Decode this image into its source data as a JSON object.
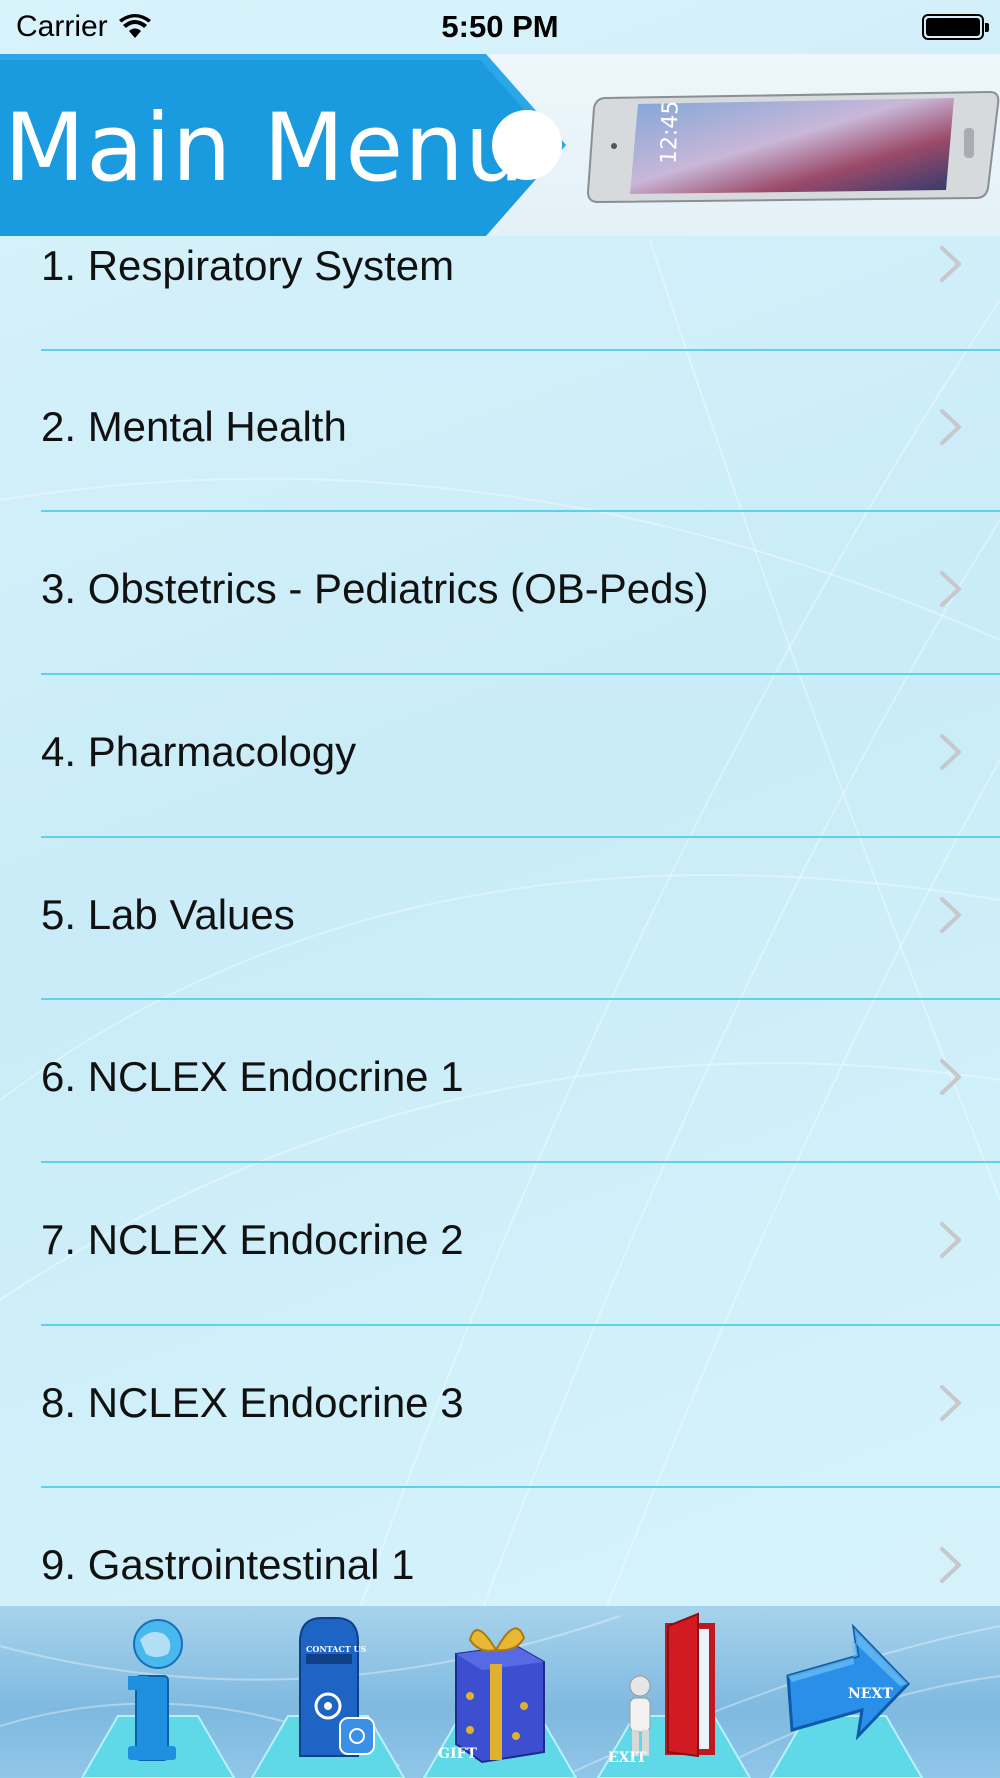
{
  "status_bar": {
    "carrier": "Carrier",
    "time": "5:50 PM",
    "wifi_icon": "wifi-icon",
    "battery_icon": "battery-icon"
  },
  "header": {
    "title": "Main Menu",
    "image_icon": "smartphone-image"
  },
  "menu": {
    "items": [
      {
        "label": "1. Respiratory System"
      },
      {
        "label": "2. Mental Health"
      },
      {
        "label": "3. Obstetrics - Pediatrics (OB-Peds)"
      },
      {
        "label": "4. Pharmacology"
      },
      {
        "label": "5. Lab Values"
      },
      {
        "label": "6. NCLEX Endocrine 1"
      },
      {
        "label": "7. NCLEX Endocrine 2"
      },
      {
        "label": "8. NCLEX Endocrine 3"
      },
      {
        "label": "9. Gastrointestinal 1"
      }
    ],
    "chevron_icon": "chevron-right-icon"
  },
  "toolbar": {
    "info_icon": "info-icon",
    "contact_icon": "mailbox-icon",
    "contact_caption": "CONTACT US",
    "gift_icon": "gift-icon",
    "gift_caption": "GIFT",
    "exit_icon": "exit-door-icon",
    "exit_caption": "EXIT",
    "next_icon": "next-arrow-icon",
    "next_caption": "NEXT"
  },
  "colors": {
    "banner_blue": "#1a9be0",
    "separator": "#5fd3e6",
    "chevron": "#c7c7cc"
  }
}
